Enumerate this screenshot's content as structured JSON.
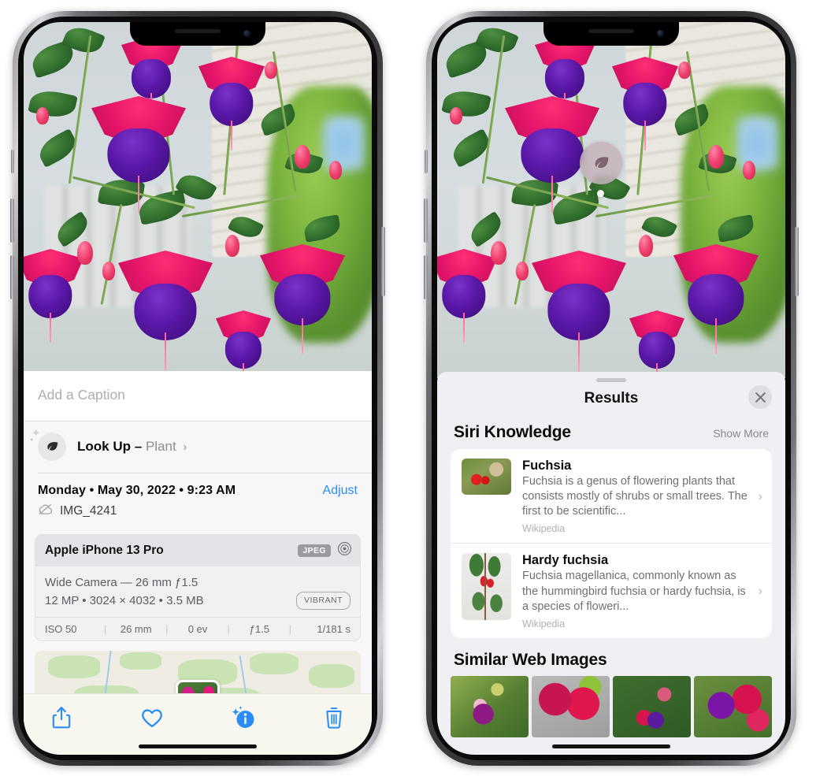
{
  "left_phone": {
    "caption_placeholder": "Add a Caption",
    "lookup": {
      "label": "Look Up",
      "dash": "–",
      "kind": "Plant",
      "chevron": "chevron-right-icon",
      "icon": "leaf-icon"
    },
    "meta": {
      "date": "Monday • May 30, 2022 • 9:23 AM",
      "adjust": "Adjust",
      "filename": "IMG_4241",
      "cloud_icon": "cloud-slash-icon"
    },
    "camera": {
      "device": "Apple iPhone 13 Pro",
      "format_badge": "JPEG",
      "lens_icon": "aperture-icon",
      "lens_line": "Wide Camera — 26 mm ƒ1.5",
      "spec_line": "12 MP • 3024 × 4032 • 3.5 MB",
      "style_badge": "VIBRANT",
      "exif": [
        "ISO 50",
        "26 mm",
        "0 ev",
        "ƒ1.5",
        "1/181 s"
      ]
    },
    "toolbar": [
      {
        "name": "share-icon",
        "label": "Share"
      },
      {
        "name": "heart-icon",
        "label": "Favorite"
      },
      {
        "name": "info-sparkle-icon",
        "label": "Info"
      },
      {
        "name": "trash-icon",
        "label": "Delete"
      }
    ]
  },
  "right_phone": {
    "badge": {
      "icon": "leaf-icon"
    },
    "sheet": {
      "title": "Results",
      "close_icon": "close-icon"
    },
    "siri_knowledge": {
      "heading": "Siri Knowledge",
      "action": "Show More",
      "items": [
        {
          "title": "Fuchsia",
          "description": "Fuchsia is a genus of flowering plants that consists mostly of shrubs or small trees. The first to be scientific...",
          "source": "Wikipedia",
          "thumb": "fuchsia-wild-thumb",
          "chevron": "chevron-right-icon"
        },
        {
          "title": "Hardy fuchsia",
          "description": "Fuchsia magellanica, commonly known as the hummingbird fuchsia or hardy fuchsia, is a species of floweri...",
          "source": "Wikipedia",
          "thumb": "hardy-fuchsia-thumb",
          "chevron": "chevron-right-icon"
        }
      ]
    },
    "similar_web_images": {
      "heading": "Similar Web Images",
      "items": [
        {
          "name": "web-image-1"
        },
        {
          "name": "web-image-2"
        },
        {
          "name": "web-image-3"
        },
        {
          "name": "web-image-4"
        }
      ]
    }
  },
  "colors": {
    "accent_blue": "#2c8cf5",
    "sheet_bg": "#f0f0f4",
    "card_bg": "#ffffff",
    "toolbar_bg": "#f7f7ef",
    "badge_gray": "#9a9aa0"
  }
}
